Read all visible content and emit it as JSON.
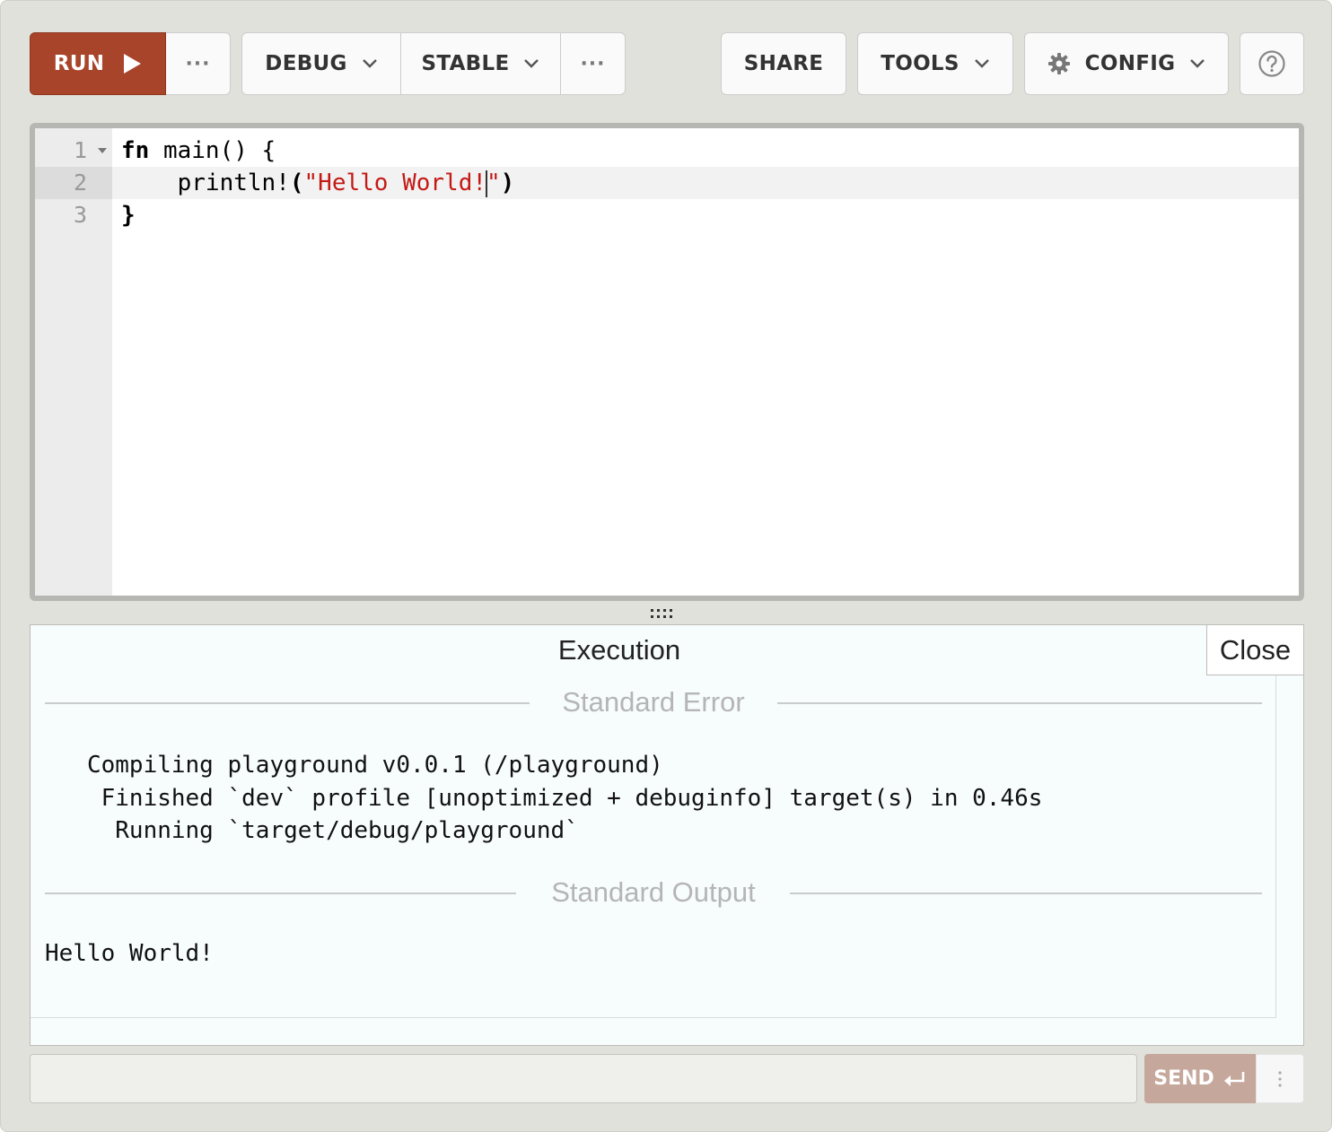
{
  "toolbar": {
    "run_label": "RUN",
    "run_more": "···",
    "mode_label": "DEBUG",
    "channel_label": "STABLE",
    "channel_more": "···",
    "share_label": "SHARE",
    "tools_label": "TOOLS",
    "config_label": "CONFIG",
    "help_icon": "question-circle-icon"
  },
  "editor": {
    "lines": [
      {
        "number": "1",
        "kw": "fn",
        "rest": " main() {"
      },
      {
        "number": "2",
        "indent": "    ",
        "macro": "println!",
        "open": "(",
        "str_before_cursor": "\"Hello World!",
        "str_after_cursor": "\"",
        "close": ")"
      },
      {
        "number": "3",
        "text": "}"
      }
    ],
    "active_line": 2
  },
  "output": {
    "title": "Execution",
    "close_label": "Close",
    "stderr_heading": "Standard Error",
    "stderr_lines": [
      "   Compiling playground v0.0.1 (/playground)",
      "    Finished `dev` profile [unoptimized + debuginfo] target(s) in 0.46s",
      "     Running `target/debug/playground`"
    ],
    "stdout_heading": "Standard Output",
    "stdout_lines": [
      "Hello World!"
    ]
  },
  "stdin": {
    "value": "",
    "send_label": "SEND",
    "more_icon": "vertical-dots-icon"
  },
  "colors": {
    "run_button": "#a8442a",
    "send_button": "#c5a79c",
    "string_literal": "#c41a16"
  }
}
